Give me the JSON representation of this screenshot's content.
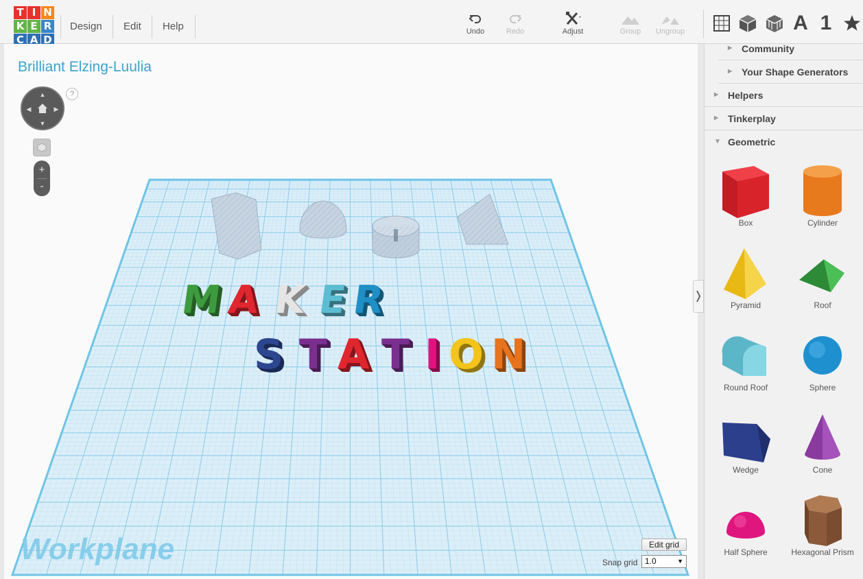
{
  "app": {
    "logo_letters": [
      "T",
      "I",
      "N",
      "K",
      "E",
      "R",
      "C",
      "A",
      "D"
    ],
    "logo_colors": [
      "#e8322c",
      "#e8322c",
      "#f5881f",
      "#62b446",
      "#62b446",
      "#3a86c8",
      "#2d6fb5",
      "#2d6fb5",
      "#2d6fb5"
    ]
  },
  "menu": {
    "items": [
      {
        "label": "Design"
      },
      {
        "label": "Edit"
      },
      {
        "label": "Help"
      }
    ]
  },
  "toolbar": {
    "undo": "Undo",
    "redo": "Redo",
    "adjust": "Adjust",
    "group": "Group",
    "ungroup": "Ungroup"
  },
  "view_tools": {
    "icons": [
      "grid-view-icon",
      "solid-cube-icon",
      "wireframe-cube-icon",
      "text-tool-icon",
      "number-tool-icon",
      "favorites-star-icon"
    ],
    "text_label": "A",
    "number_label": "1"
  },
  "design": {
    "title": "Brilliant Elzing-Luulia",
    "workplane_label": "Workplane",
    "line1_text": "MAKER",
    "line1_colors": [
      "#3d9b3f",
      "#e0262f",
      "#e5e5e5",
      "#5bbdd1",
      "#1f8fc6"
    ],
    "line2_text": "STATION",
    "line2_colors": [
      "#2c4690",
      "#7a2f8f",
      "#e0262f",
      "#7a2f8f",
      "#e0137e",
      "#f2c41c",
      "#e8731e"
    ]
  },
  "viewport_controls": {
    "help": "?",
    "zoom_in": "+",
    "zoom_out": "-",
    "edit_grid": "Edit grid",
    "snap_grid_label": "Snap grid",
    "snap_grid_value": "1.0"
  },
  "sidebar": {
    "categories": [
      {
        "name": "Community",
        "expanded": false
      },
      {
        "name": "Your Shape Generators",
        "expanded": false
      },
      {
        "name": "Helpers",
        "expanded": false
      },
      {
        "name": "Tinkerplay",
        "expanded": false
      },
      {
        "name": "Geometric",
        "expanded": true
      }
    ],
    "shapes": [
      {
        "label": "Box",
        "color": "#d9232b"
      },
      {
        "label": "Cylinder",
        "color": "#e87a1e"
      },
      {
        "label": "Pyramid",
        "color": "#f0c419"
      },
      {
        "label": "Roof",
        "color": "#3aa645"
      },
      {
        "label": "Round Roof",
        "color": "#6dc6d6"
      },
      {
        "label": "Sphere",
        "color": "#1e90cf"
      },
      {
        "label": "Wedge",
        "color": "#2c3f8c"
      },
      {
        "label": "Cone",
        "color": "#8b3aa0"
      },
      {
        "label": "Half Sphere",
        "color": "#e0167f"
      },
      {
        "label": "Hexagonal Prism",
        "color": "#8a5a3a"
      }
    ]
  }
}
